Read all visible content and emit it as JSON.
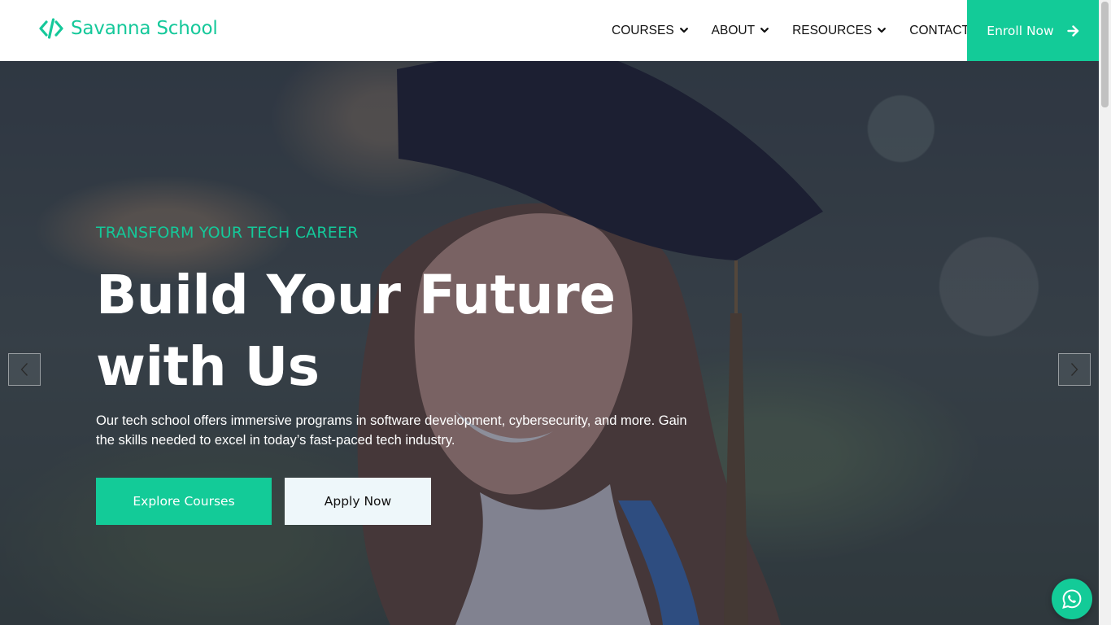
{
  "brand": {
    "name": "Savanna School",
    "icon": "code-brackets-icon",
    "color": "#15c89a"
  },
  "nav": {
    "items": [
      {
        "label": "COURSES",
        "has_dropdown": true
      },
      {
        "label": "ABOUT",
        "has_dropdown": true
      },
      {
        "label": "RESOURCES",
        "has_dropdown": true
      },
      {
        "label": "CONTACT",
        "has_dropdown": false
      }
    ],
    "enroll_label": "Enroll Now",
    "enroll_icon": "arrow-right-icon"
  },
  "hero": {
    "eyebrow": "TRANSFORM YOUR TECH CAREER",
    "headline": "Build Your Future with Us",
    "description": "Our tech school offers immersive programs in software development, cybersecurity, and more. Gain the skills needed to excel in today’s fast-paced tech industry.",
    "primary_cta": "Explore Courses",
    "secondary_cta": "Apply Now",
    "prev_icon": "chevron-left-icon",
    "next_icon": "chevron-right-icon"
  },
  "floating": {
    "whatsapp_icon": "whatsapp-icon"
  },
  "colors": {
    "accent": "#13cb98",
    "overlay": "#22263e",
    "secondary_button_bg": "#eef7fa"
  }
}
